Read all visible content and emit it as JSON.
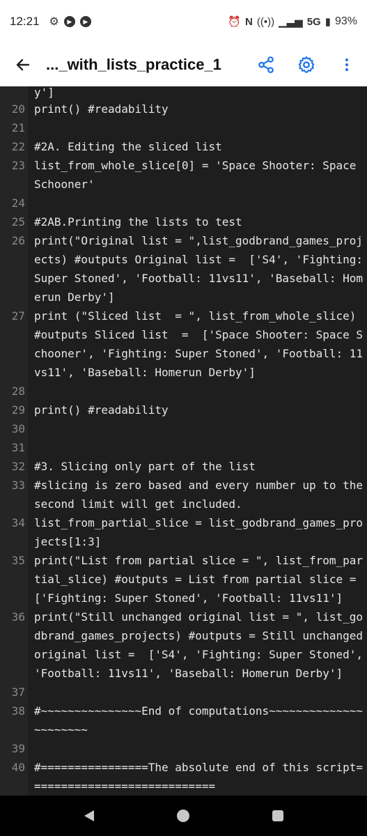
{
  "status": {
    "time": "12:21",
    "network": "5G",
    "battery": "93%"
  },
  "appbar": {
    "title": "..._with_lists_practice_1"
  },
  "lines": [
    {
      "num": "",
      "text": "y']"
    },
    {
      "num": "20",
      "text": "print() #readability"
    },
    {
      "num": "21",
      "text": ""
    },
    {
      "num": "22",
      "text": "#2A. Editing the sliced list"
    },
    {
      "num": "23",
      "text": "list_from_whole_slice[0] = 'Space Shooter: Space Schooner'"
    },
    {
      "num": "24",
      "text": ""
    },
    {
      "num": "25",
      "text": "#2AB.Printing the lists to test"
    },
    {
      "num": "26",
      "text": "print(\"Original list = \",list_godbrand_games_projects) #outputs Original list =  ['S4', 'Fighting: Super Stoned', 'Football: 11vs11', 'Baseball: Homerun Derby']"
    },
    {
      "num": "27",
      "text": "print (\"Sliced list  = \", list_from_whole_slice) #outputs Sliced list  =  ['Space Shooter: Space Schooner', 'Fighting: Super Stoned', 'Football: 11vs11', 'Baseball: Homerun Derby']"
    },
    {
      "num": "28",
      "text": ""
    },
    {
      "num": "29",
      "text": "print() #readability"
    },
    {
      "num": "30",
      "text": ""
    },
    {
      "num": "31",
      "text": ""
    },
    {
      "num": "32",
      "text": "#3. Slicing only part of the list"
    },
    {
      "num": "33",
      "text": "#slicing is zero based and every number up to the second limit will get included."
    },
    {
      "num": "34",
      "text": "list_from_partial_slice = list_godbrand_games_projects[1:3]"
    },
    {
      "num": "35",
      "text": "print(\"List from partial slice = \", list_from_partial_slice) #outputs = List from partial slice =  ['Fighting: Super Stoned', 'Football: 11vs11']"
    },
    {
      "num": "36",
      "text": "print(\"Still unchanged original list = \", list_godbrand_games_projects) #outputs = Still unchanged original list =  ['S4', 'Fighting: Super Stoned', 'Football: 11vs11', 'Baseball: Homerun Derby']"
    },
    {
      "num": "37",
      "text": ""
    },
    {
      "num": "38",
      "text": "#~~~~~~~~~~~~~~~End of computations~~~~~~~~~~~~~~~~~~~~~~"
    },
    {
      "num": "39",
      "text": ""
    },
    {
      "num": "40",
      "text": "#================The absolute end of this script============================"
    }
  ],
  "colors": {
    "editor_bg": "#1e1e1e",
    "gutter_bg": "#252526",
    "accent": "#1a73e8"
  },
  "icons": {
    "back": "arrow-left-icon",
    "share": "share-icon",
    "settings": "gear-icon",
    "more": "more-vert-icon"
  }
}
